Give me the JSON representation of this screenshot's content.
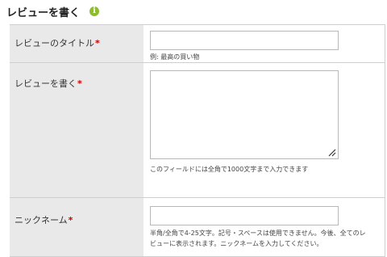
{
  "header": {
    "title": "レビューを書く",
    "info_icon": "info-icon",
    "info_glyph": "i",
    "info_color": "#8dbd2c"
  },
  "form": {
    "required_mark": "*",
    "required_color": "#cc0000",
    "rows": [
      {
        "label": "レビューのタイトル",
        "field_type": "text",
        "value": "",
        "help": "例: 最高の買い物"
      },
      {
        "label": "レビューを書く",
        "field_type": "textarea",
        "value": "",
        "help": "このフィールドには全角で1000文字まで入力できます"
      },
      {
        "label": "ニックネーム",
        "field_type": "text",
        "value": "",
        "help_lines": [
          "半角/全角で4-25文字。記号・スペースは使用できません。今後、全てのレ",
          "ビューに表示されます。ニックネームを入力してください。"
        ]
      }
    ]
  }
}
